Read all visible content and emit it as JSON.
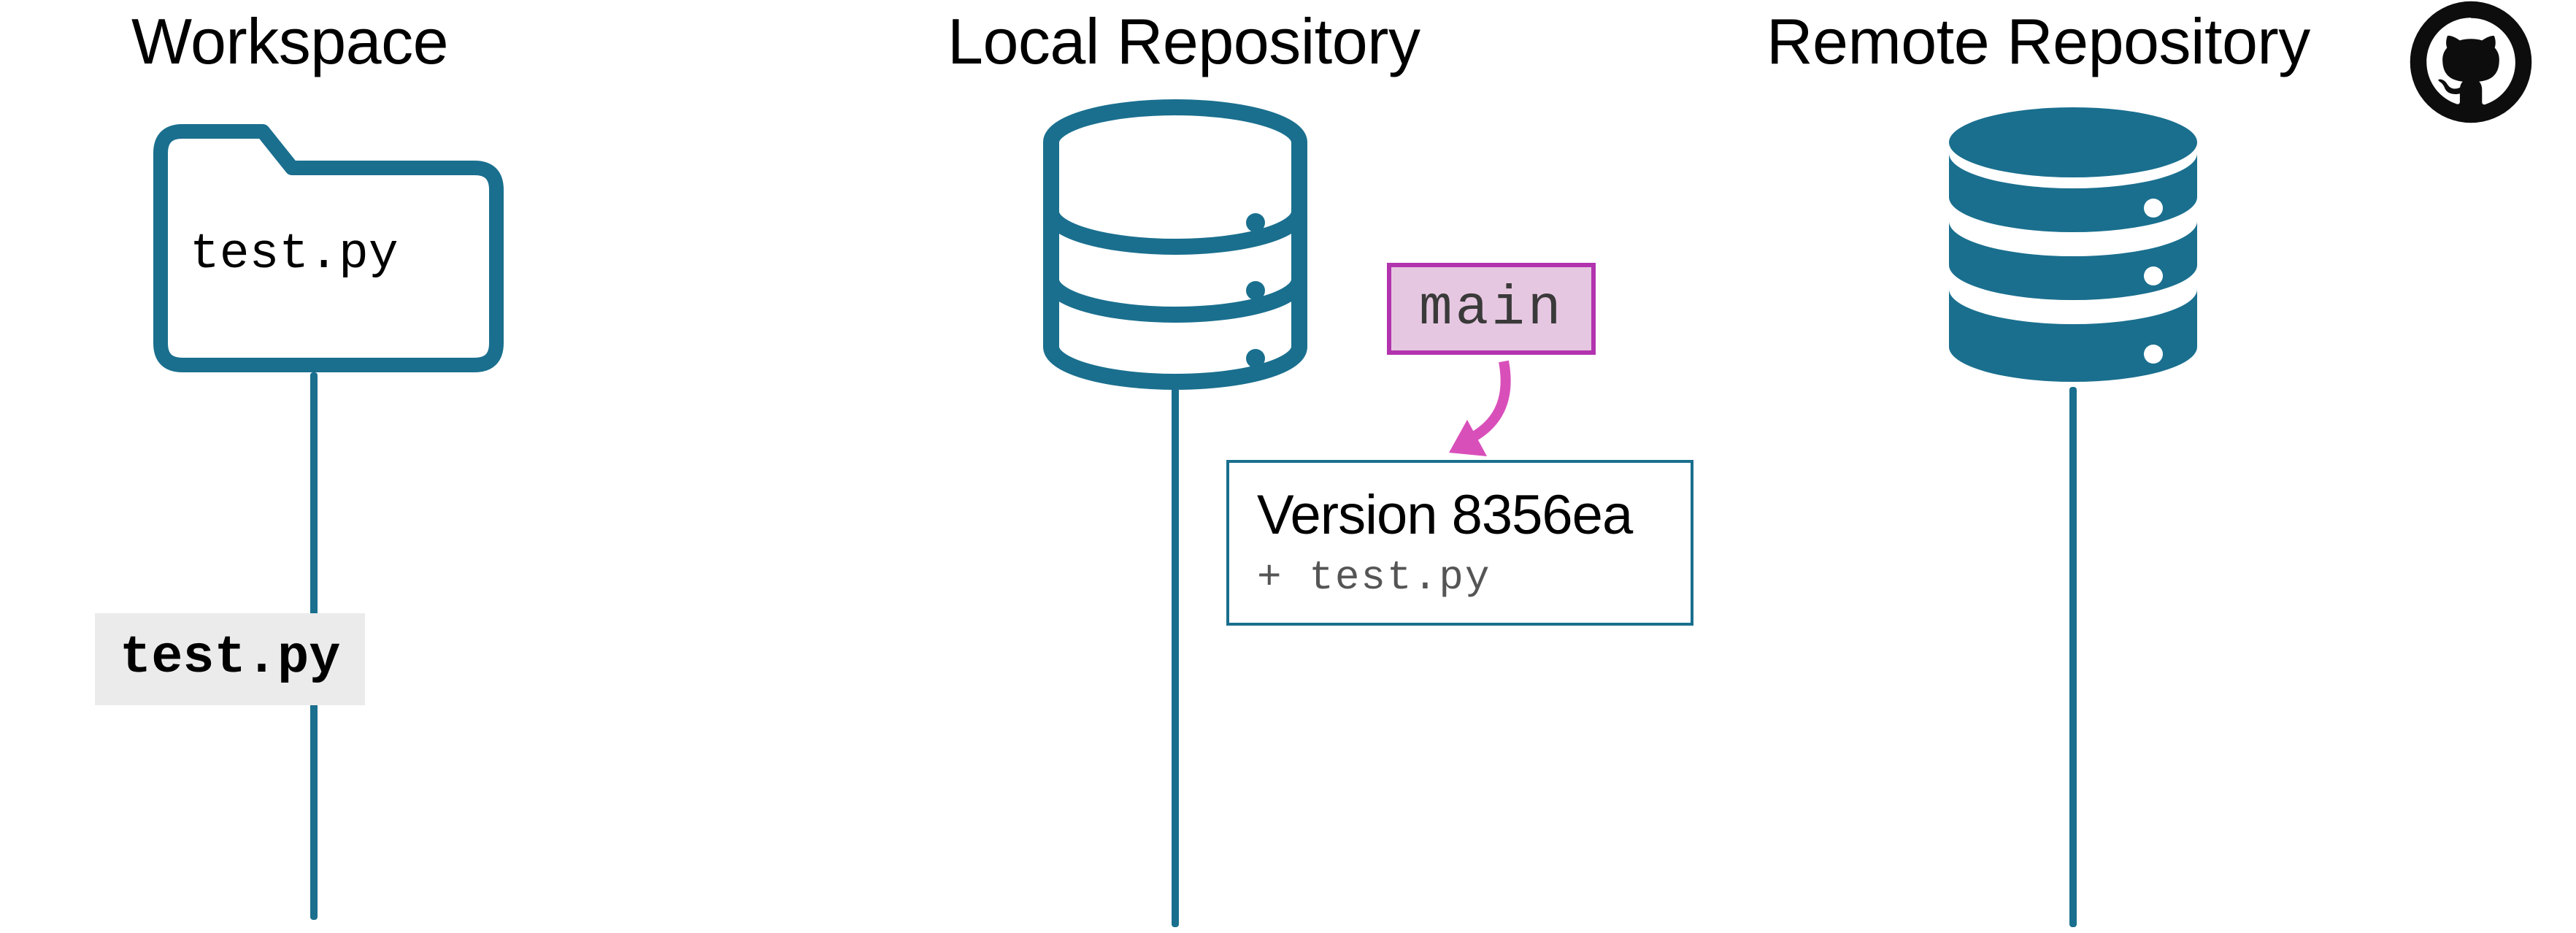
{
  "columns": {
    "workspace": {
      "title": "Workspace",
      "folder_file": "test.py",
      "timeline_file": "test.py"
    },
    "local": {
      "title": "Local Repository",
      "branch": "main",
      "commit": {
        "title": "Version 8356ea",
        "file": "+ test.py"
      }
    },
    "remote": {
      "title": "Remote Repository"
    }
  },
  "colors": {
    "db_stroke": "#1a6f8e",
    "db_fill_solid": "#1a6f8e",
    "branch_border": "#b233ae",
    "branch_fill": "#e6c7e1",
    "arrow": "#d94fba"
  }
}
